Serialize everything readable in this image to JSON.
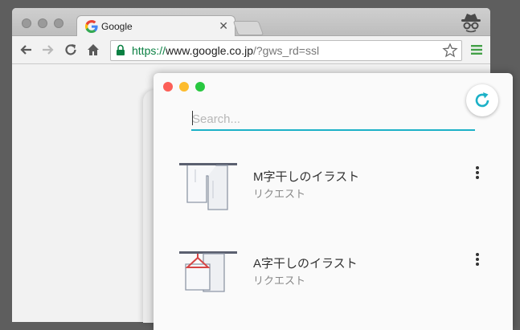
{
  "browser": {
    "tab_title": "Google",
    "url": {
      "scheme": "https://",
      "host": "www.google.co.jp",
      "path": "/?gws_rd=ssl"
    },
    "icons": [
      "back-arrow-icon",
      "forward-arrow-icon",
      "reload-icon",
      "home-icon",
      "lock-icon",
      "bookmark-star-icon",
      "chrome-menu-icon",
      "incognito-icon",
      "tab-close-icon"
    ],
    "colors": {
      "secure_green": "#0b8043",
      "google_blue": "#4285f4"
    }
  },
  "app": {
    "search": {
      "placeholder": "Search..."
    },
    "accent": "#1cb1c7",
    "refresh_icon": "refresh-icon",
    "items": [
      {
        "title": "M字干しのイラスト",
        "subtitle": "リクエスト",
        "thumb_icon": "laundry-m-dry-icon"
      },
      {
        "title": "A字干しのイラスト",
        "subtitle": "リクエスト",
        "thumb_icon": "laundry-a-dry-hanger-icon"
      }
    ]
  }
}
